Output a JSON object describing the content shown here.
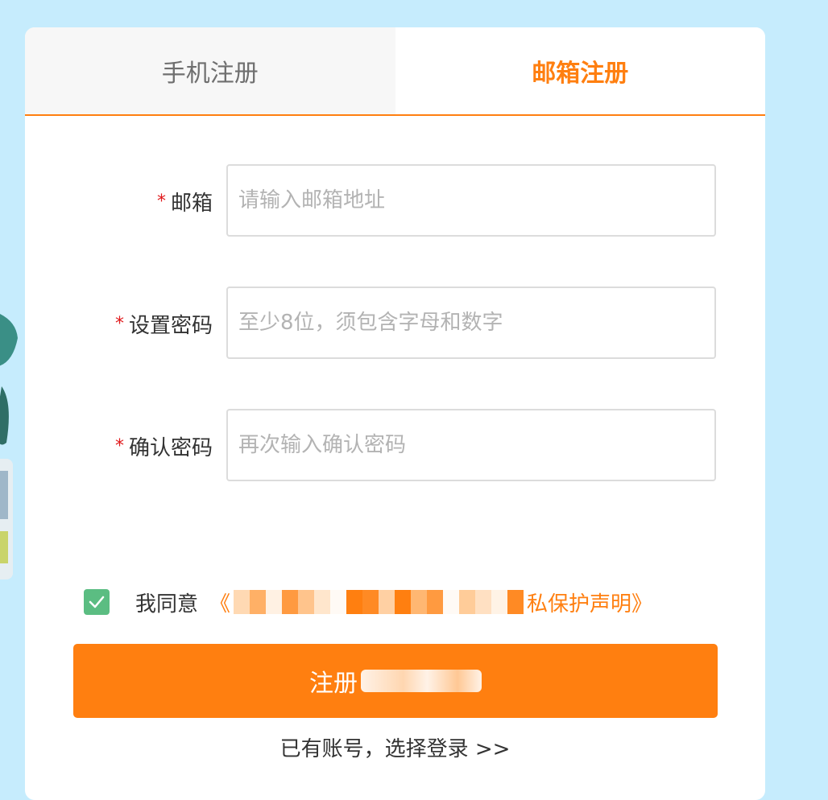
{
  "tabs": [
    {
      "label": "手机注册",
      "active": false
    },
    {
      "label": "邮箱注册",
      "active": true
    }
  ],
  "form": {
    "required_mark": "*",
    "email": {
      "label": "邮箱",
      "placeholder": "请输入邮箱地址",
      "value": ""
    },
    "password": {
      "label": "设置密码",
      "placeholder": "至少8位，须包含字母和数字",
      "value": ""
    },
    "confirm": {
      "label": "确认密码",
      "placeholder": "再次输入确认密码",
      "value": ""
    }
  },
  "agreement": {
    "checked": true,
    "prefix": "我同意",
    "link_start": "《",
    "link_end": "私保护声明》"
  },
  "submit": {
    "label": "注册"
  },
  "login": {
    "label": "已有账号，选择登录 >>"
  },
  "colors": {
    "accent": "#ff7f10",
    "background": "#c6ecfd",
    "checkbox": "#5bbd82",
    "required": "#e0191b"
  }
}
